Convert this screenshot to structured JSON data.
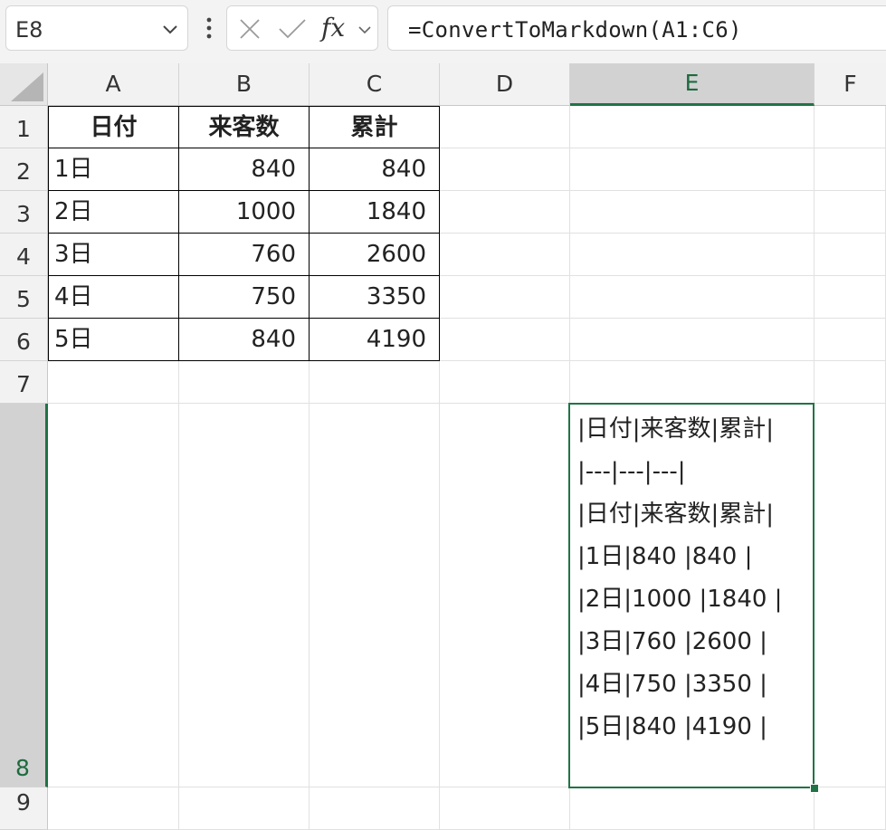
{
  "name_box": {
    "value": "E8"
  },
  "formula_bar": {
    "fx_label": "fx",
    "formula": "=ConvertToMarkdown(A1:C6)"
  },
  "columns": [
    "A",
    "B",
    "C",
    "D",
    "E",
    "F"
  ],
  "selected_column": "E",
  "rows": [
    "1",
    "2",
    "3",
    "4",
    "5",
    "6",
    "7",
    "8",
    "9"
  ],
  "selected_row": "8",
  "table": {
    "headers": [
      "日付",
      "来客数",
      "累計"
    ],
    "body": [
      [
        "1日",
        "840",
        "840"
      ],
      [
        "2日",
        "1000",
        "1840"
      ],
      [
        "3日",
        "760",
        "2600"
      ],
      [
        "4日",
        "750",
        "3350"
      ],
      [
        "5日",
        "840",
        "4190"
      ]
    ]
  },
  "active_cell": {
    "ref": "E8",
    "lines": [
      "|日付|来客数|累計|",
      "|---|---|---|",
      "|日付|来客数|累計|",
      "|1日|840 |840 |",
      "|2日|1000 |1840 |",
      "|3日|760 |2600 |",
      "|4日|750 |3350 |",
      "|5日|840 |4190 |"
    ]
  },
  "colors": {
    "accent": "#217346",
    "header_bg": "#f2f2f2",
    "selected_header_bg": "#d2d2d2"
  }
}
